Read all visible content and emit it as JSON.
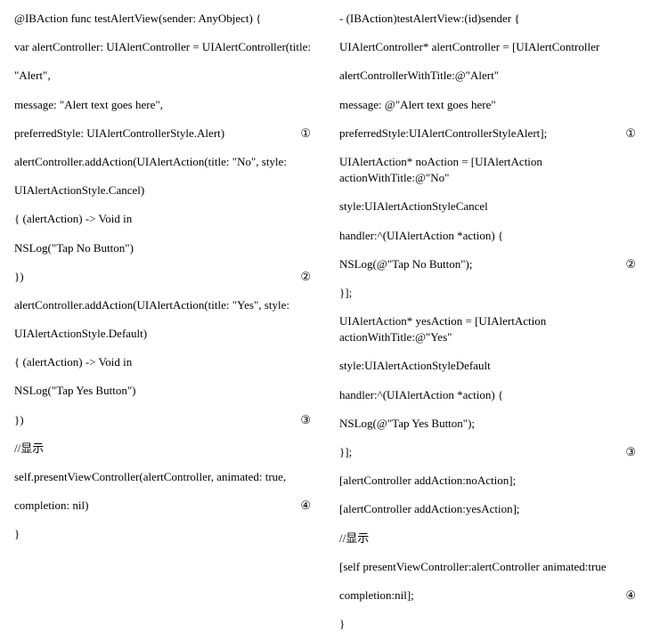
{
  "left": {
    "lines": [
      {
        "text": "@IBAction func testAlertView(sender: AnyObject) {",
        "marker": null
      },
      {
        "text": "var alertController: UIAlertController = UIAlertController(title:",
        "marker": null
      },
      {
        "text": "\"Alert\",",
        "marker": null
      },
      {
        "text": "message: \"Alert text goes here\",",
        "marker": null
      },
      {
        "text": "preferredStyle: UIAlertControllerStyle.Alert)",
        "marker": "①"
      },
      {
        "text": "alertController.addAction(UIAlertAction(title: \"No\", style:",
        "marker": null
      },
      {
        "text": "UIAlertActionStyle.Cancel)",
        "marker": null
      },
      {
        "text": "{ (alertAction) -> Void in",
        "marker": null
      },
      {
        "text": "NSLog(\"Tap No Button\")",
        "marker": null
      },
      {
        "text": "})",
        "marker": "②"
      },
      {
        "text": "alertController.addAction(UIAlertAction(title: \"Yes\", style:",
        "marker": null
      },
      {
        "text": "UIAlertActionStyle.Default)",
        "marker": null
      },
      {
        "text": "{ (alertAction) -> Void in",
        "marker": null
      },
      {
        "text": "NSLog(\"Tap Yes Button\")",
        "marker": null
      },
      {
        "text": "})",
        "marker": "③"
      },
      {
        "text": "//显示",
        "marker": null
      },
      {
        "text": "self.presentViewController(alertController, animated: true,",
        "marker": null
      },
      {
        "text": "completion: nil)",
        "marker": "④"
      },
      {
        "text": "}",
        "marker": null
      }
    ]
  },
  "right": {
    "lines": [
      {
        "text": "- (IBAction)testAlertView:(id)sender {",
        "marker": null
      },
      {
        "text": "UIAlertController* alertController = [UIAlertController",
        "marker": null
      },
      {
        "text": "alertControllerWithTitle:@\"Alert\"",
        "marker": null
      },
      {
        "text": "message: @\"Alert text goes here\"",
        "marker": null
      },
      {
        "text": "preferredStyle:UIAlertControllerStyleAlert];",
        "marker": "①"
      },
      {
        "text": "UIAlertAction* noAction = [UIAlertAction actionWithTitle:@\"No\"",
        "marker": null
      },
      {
        "text": "style:UIAlertActionStyleCancel",
        "marker": null
      },
      {
        "text": "handler:^(UIAlertAction *action) {",
        "marker": null
      },
      {
        "text": "NSLog(@\"Tap No Button\");",
        "marker": "②"
      },
      {
        "text": "}];",
        "marker": null
      },
      {
        "text": "UIAlertAction* yesAction = [UIAlertAction actionWithTitle:@\"Yes\"",
        "marker": null
      },
      {
        "text": "style:UIAlertActionStyleDefault",
        "marker": null
      },
      {
        "text": "handler:^(UIAlertAction *action) {",
        "marker": null
      },
      {
        "text": "NSLog(@\"Tap Yes Button\");",
        "marker": null
      },
      {
        "text": "}];",
        "marker": "③"
      },
      {
        "text": "[alertController addAction:noAction];",
        "marker": null
      },
      {
        "text": "[alertController addAction:yesAction];",
        "marker": null
      },
      {
        "text": "//显示",
        "marker": null
      },
      {
        "text": "[self presentViewController:alertController animated:true",
        "marker": null
      },
      {
        "text": "completion:nil];",
        "marker": "④"
      },
      {
        "text": "}",
        "marker": null
      }
    ]
  }
}
